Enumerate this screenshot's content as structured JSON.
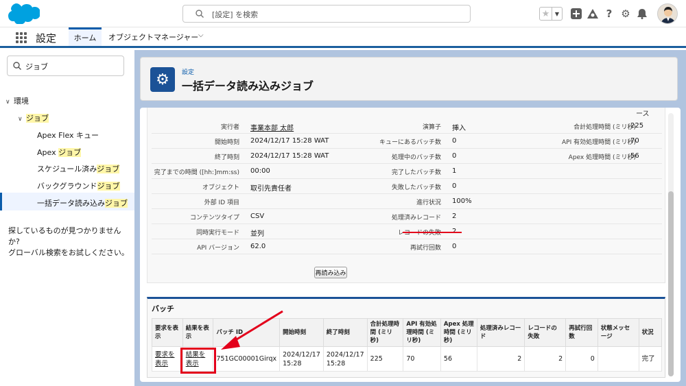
{
  "search": {
    "placeholder": "[設定] を検索"
  },
  "app": {
    "name": "設定",
    "tabs": {
      "home": "ホーム",
      "object_manager": "オブジェクトマネージャー"
    }
  },
  "sidebar": {
    "quickfind_value": "ジョブ",
    "tree": {
      "env": "環境",
      "jobs": "ジョブ",
      "items": [
        {
          "pre": "Apex Flex キュー",
          "hl": ""
        },
        {
          "pre": "Apex ",
          "hl": "ジョブ"
        },
        {
          "pre": "スケジュール済み",
          "hl": "ジョブ"
        },
        {
          "pre": "バックグラウンド",
          "hl": "ジョブ"
        },
        {
          "pre": "一括データ読み込み",
          "hl": "ジョブ"
        }
      ]
    },
    "help_line1": "探しているものが見つかりませんか?",
    "help_line2": "グローバル検索をお試しください。"
  },
  "page_header": {
    "subtitle": "設定",
    "title": "一括データ読み込みジョブ"
  },
  "detail": {
    "cut_text": "ース",
    "rows": [
      {
        "l1": "実行者",
        "v1": "事業本部 太郎",
        "l2": "演算子",
        "v2": "挿入",
        "l3": "合計処理時間 (ミリ秒)",
        "v3": "225"
      },
      {
        "l1": "開始時刻",
        "v1": "2024/12/17 15:28 WAT",
        "l2": "キューにあるバッチ数",
        "v2": "0",
        "l3": "API 有効処理時間 (ミリ秒)",
        "v3": "70"
      },
      {
        "l1": "終了時刻",
        "v1": "2024/12/17 15:28 WAT",
        "l2": "処理中のバッチ数",
        "v2": "0",
        "l3": "Apex 処理時間 (ミリ秒)",
        "v3": "56"
      },
      {
        "l1": "完了までの時間 ([hh:]mm:ss)",
        "v1": "00:00",
        "l2": "完了したバッチ数",
        "v2": "1",
        "l3": "",
        "v3": ""
      },
      {
        "l1": "オブジェクト",
        "v1": "取引先責任者",
        "l2": "失敗したバッチ数",
        "v2": "0",
        "l3": "",
        "v3": ""
      },
      {
        "l1": "外部 ID 項目",
        "v1": "",
        "l2": "進行状況",
        "v2": "100%",
        "l3": "",
        "v3": ""
      },
      {
        "l1": "コンテンツタイプ",
        "v1": "CSV",
        "l2": "処理済みレコード",
        "v2": "2",
        "l3": "",
        "v3": ""
      },
      {
        "l1": "同時実行モード",
        "v1": "並列",
        "l2": "レコードの失敗",
        "v2": "2",
        "l3": "",
        "v3": ""
      },
      {
        "l1": "API バージョン",
        "v1": "62.0",
        "l2": "再試行回数",
        "v2": "0",
        "l3": "",
        "v3": ""
      }
    ],
    "reload_label": "再読み込み"
  },
  "batch": {
    "title": "バッチ",
    "columns": [
      "要求を表示",
      "結果を表示",
      "バッチ ID",
      "開始時刻",
      "終了時刻",
      "合計処理時間 (ミリ秒)",
      "API 有効処理時間 (ミリ秒)",
      "Apex 処理時間 (ミリ秒)",
      "処理済みレコード",
      "レコードの失敗",
      "再試行回数",
      "状態メッセージ",
      "状況"
    ],
    "row": {
      "request": "要求を表示",
      "result": "結果を表示",
      "batch_id": "751GC00001Girqx",
      "start": "2024/12/17 15:28",
      "end": "2024/12/17 15:28",
      "total_ms": "225",
      "api_ms": "70",
      "apex_ms": "56",
      "processed": "2",
      "failed": "2",
      "retries": "0",
      "message": "",
      "status": "完了"
    }
  },
  "colors": {
    "brand": "#0b5cab",
    "highlight": "#fff6a8",
    "annotation": "#e3001b",
    "background": "#b0c4df"
  }
}
